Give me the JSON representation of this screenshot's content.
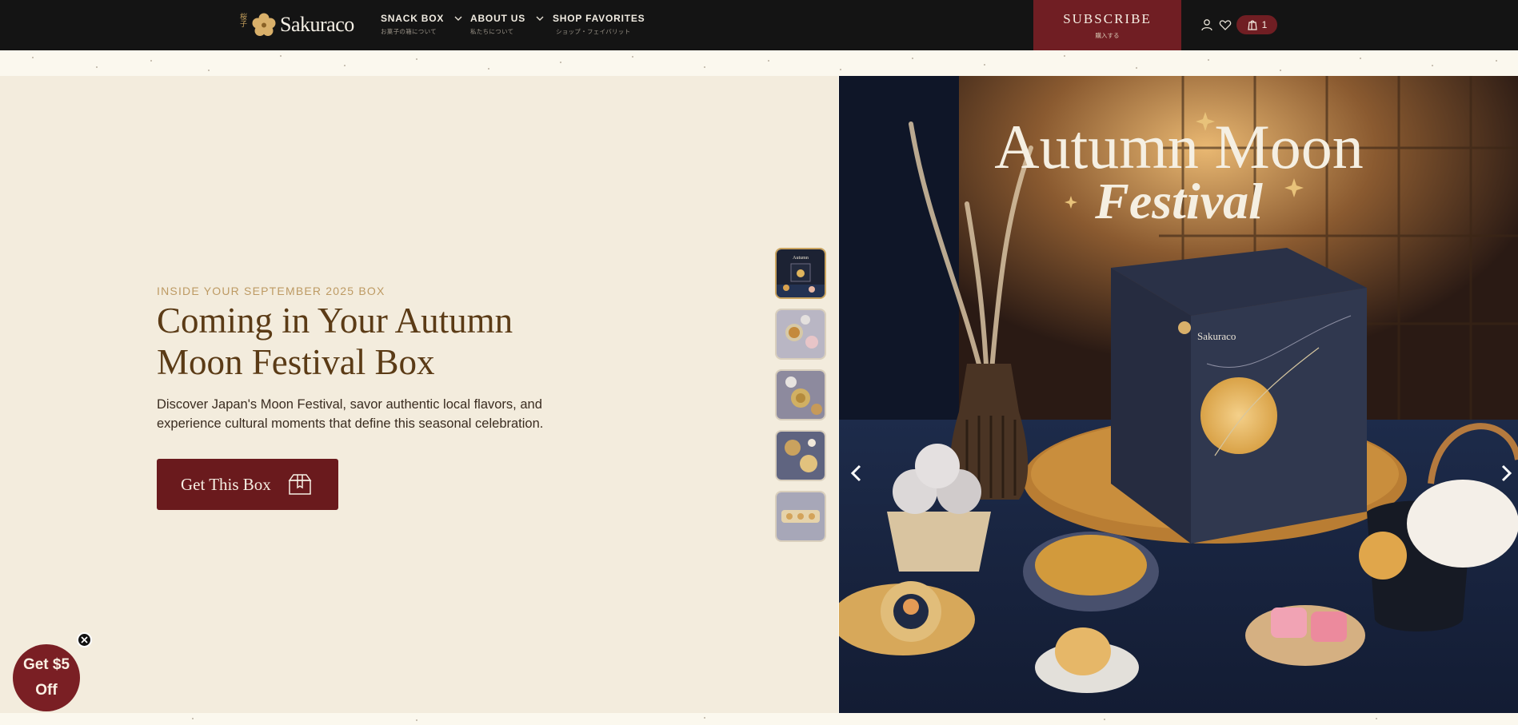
{
  "header": {
    "logo_kanji": "桜子",
    "logo_text": "Sakuraco",
    "nav": [
      {
        "label": "SNACK BOX",
        "sub": "お菓子の箱について"
      },
      {
        "label": "ABOUT US",
        "sub": "私たちについて"
      },
      {
        "label": "SHOP FAVORITES",
        "sub": "ショップ・フェイバリット"
      }
    ],
    "subscribe_label": "SUBSCRIBE",
    "subscribe_sub": "購入する",
    "cart_count": "1",
    "icons": [
      "user-icon",
      "heart-icon",
      "cart-icon"
    ]
  },
  "hero": {
    "eyebrow": "INSIDE YOUR SEPTEMBER 2025 BOX",
    "headline": "Coming in Your Autumn Moon Festival Box",
    "description": "Discover Japan's Moon Festival, savor authentic local flavors, and experience cultural moments that define this seasonal celebration.",
    "cta_label": "Get This Box",
    "image_title_line1": "Autumn Moon",
    "image_title_line2": "Festival",
    "box_brand": "Sakuraco",
    "thumbnail_count": 5,
    "active_thumbnail": 1
  },
  "promo": {
    "line1": "Get $5",
    "line2": "Off"
  },
  "colors": {
    "header_bg": "#141414",
    "accent_maroon": "#701e23",
    "gold": "#c9a35e",
    "cream": "#f3ecdd",
    "headline_brown": "#5b3b16"
  }
}
